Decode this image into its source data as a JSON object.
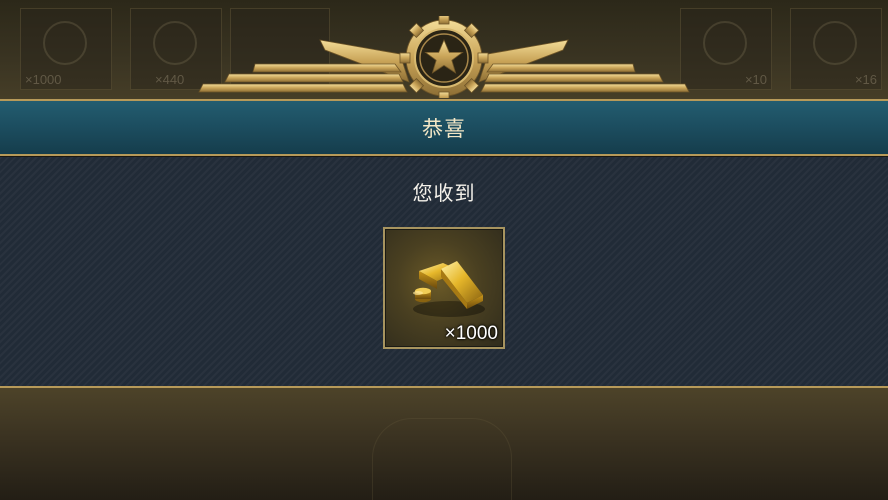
{
  "background": {
    "tiles": [
      {
        "qty": "×1000"
      },
      {
        "qty": "×440"
      },
      {
        "qty": ""
      },
      {
        "qty": "×10"
      },
      {
        "qty": "×16"
      }
    ]
  },
  "emblem": {
    "icon": "star-gear-wings-emblem"
  },
  "banner": {
    "title": "恭喜"
  },
  "dialog": {
    "subtitle": "您收到",
    "reward": {
      "icon": "gold-bars-icon",
      "quantity": "×1000"
    }
  },
  "colors": {
    "gold_trim": "#b79a59",
    "banner_teal": "#1c4d5f",
    "panel_bg": "#212b37"
  }
}
